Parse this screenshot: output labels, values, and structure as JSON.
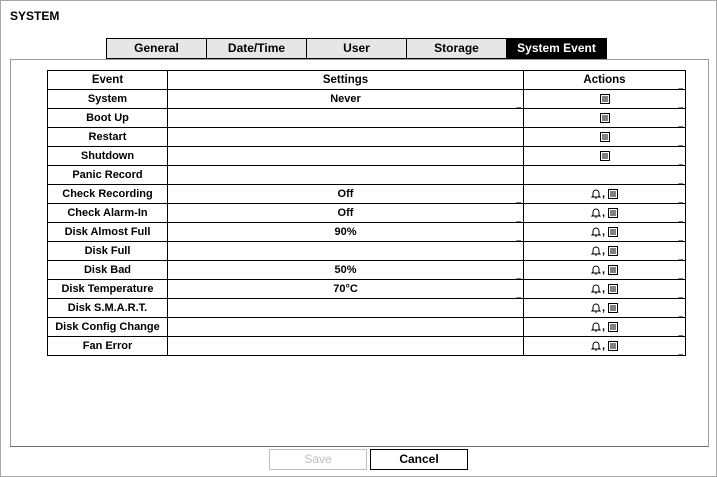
{
  "title": "SYSTEM",
  "tabs": [
    "General",
    "Date/Time",
    "User",
    "Storage",
    "System Event"
  ],
  "active_tab": "System Event",
  "table": {
    "headers": {
      "event": "Event",
      "settings": "Settings",
      "actions": "Actions"
    },
    "rows": [
      {
        "event": "System",
        "settings": "Never",
        "actions": "list-icon"
      },
      {
        "event": "Boot Up",
        "settings": "",
        "actions": "list-icon"
      },
      {
        "event": "Restart",
        "settings": "",
        "actions": "list-icon"
      },
      {
        "event": "Shutdown",
        "settings": "",
        "actions": "list-icon"
      },
      {
        "event": "Panic Record",
        "settings": "",
        "actions": ""
      },
      {
        "event": "Check Recording",
        "settings": "Off",
        "actions": "bell-icon,list-icon"
      },
      {
        "event": "Check Alarm-In",
        "settings": "Off",
        "actions": "bell-icon,list-icon"
      },
      {
        "event": "Disk Almost Full",
        "settings": "90%",
        "actions": "bell-icon,list-icon"
      },
      {
        "event": "Disk Full",
        "settings": "",
        "actions": "bell-icon,list-icon"
      },
      {
        "event": "Disk Bad",
        "settings": "50%",
        "actions": "bell-icon,list-icon"
      },
      {
        "event": "Disk Temperature",
        "settings": "70°C",
        "actions": "bell-icon,list-icon"
      },
      {
        "event": "Disk S.M.A.R.T.",
        "settings": "",
        "actions": "bell-icon,list-icon"
      },
      {
        "event": "Disk Config Change",
        "settings": "",
        "actions": "bell-icon,list-icon"
      },
      {
        "event": "Fan Error",
        "settings": "",
        "actions": "bell-icon,list-icon"
      }
    ]
  },
  "buttons": {
    "save": "Save",
    "cancel": "Cancel"
  },
  "colors": {
    "active_tab_bg": "#000000",
    "tab_bg": "#e6e6e6",
    "disabled_text": "#bdbdbd"
  }
}
